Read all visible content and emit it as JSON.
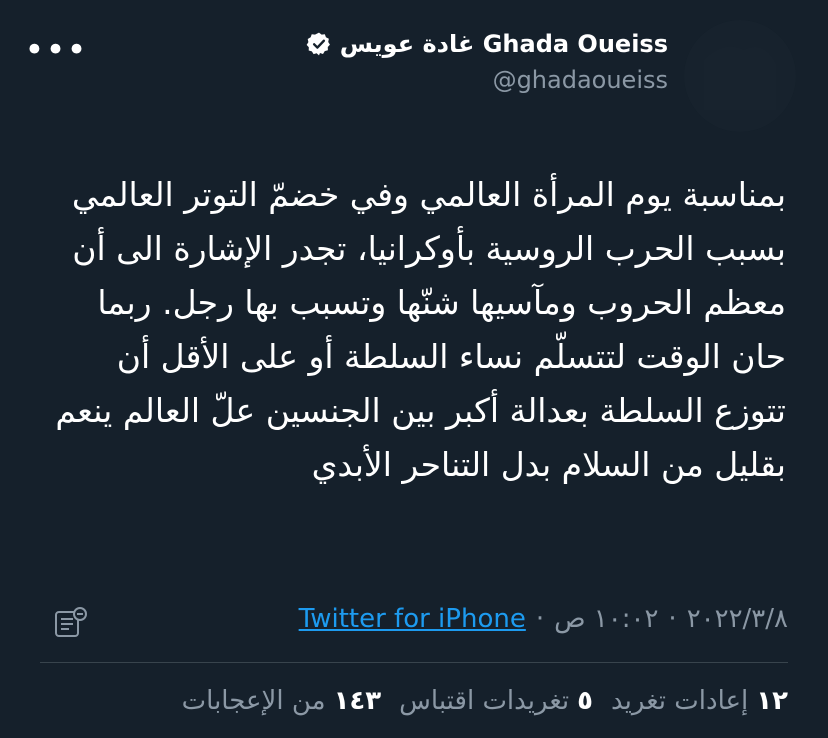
{
  "author": {
    "name": "Ghada Oueiss غادة عويس",
    "handle": "@ghadaoueiss"
  },
  "tweet": {
    "text": "بمناسبة يوم المرأة العالمي وفي خضمّ التوتر العالمي بسبب الحرب الروسية بأوكرانيا، تجدر الإشارة الى أن معظم الحروب ومآسيها شنّها وتسبب بها رجل. ربما حان الوقت لتتسلّم نساء السلطة أو على الأقل أن تتوزع السلطة بعدالة أكبر بين الجنسين علّ العالم ينعم بقليل من السلام بدل التناحر الأبدي"
  },
  "meta": {
    "date": "٢٠٢٢/٣/٨",
    "time": "١٠:٠٢ ص",
    "source": "Twitter for iPhone",
    "separator": "·"
  },
  "stats": {
    "retweets_count": "١٢",
    "retweets_label": "إعادات تغريد",
    "quotes_count": "٥",
    "quotes_label": "تغريدات اقتباس",
    "likes_count": "١٤٣",
    "likes_label": "من الإعجابات"
  },
  "icons": {
    "more": "more-options-icon",
    "verified": "verified-badge-icon",
    "analytics": "tweet-analytics-icon"
  },
  "colors": {
    "background": "#15202b",
    "text": "#ffffff",
    "secondary": "#8b98a5",
    "link": "#1d9bf0",
    "divider": "#38444d"
  }
}
